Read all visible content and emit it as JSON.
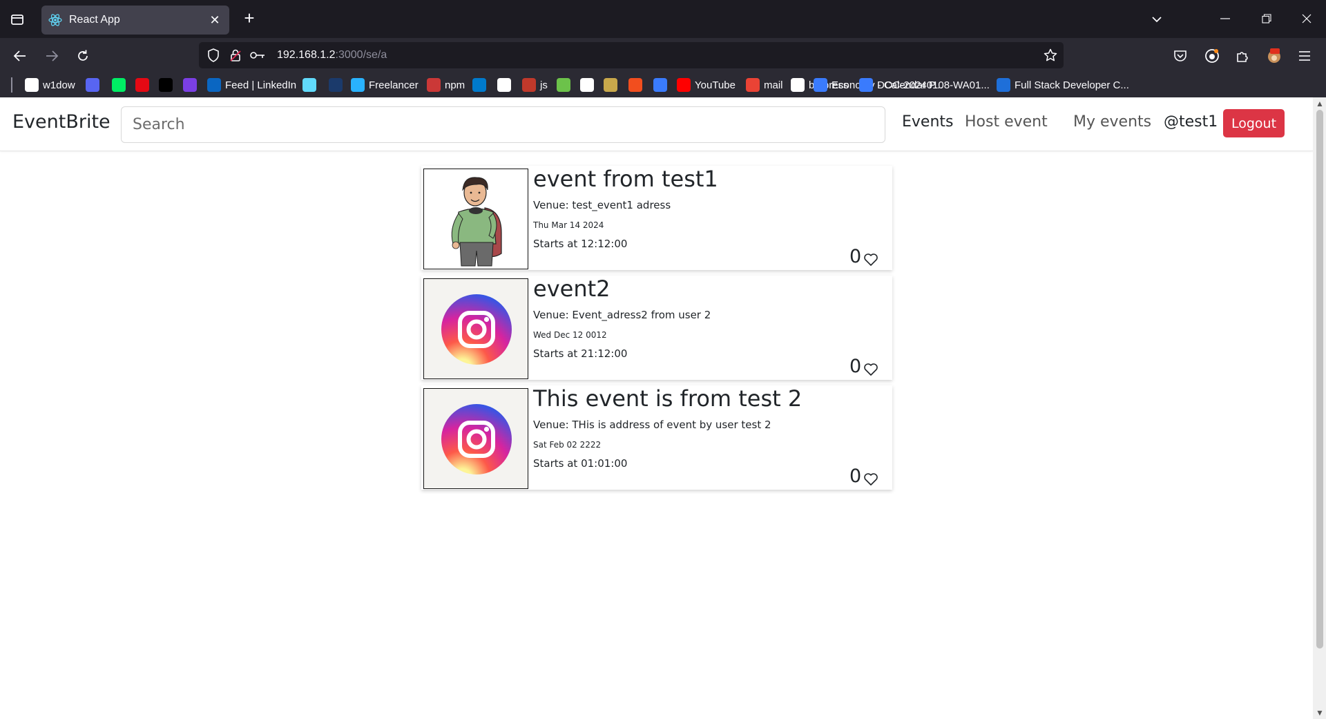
{
  "browser": {
    "tab_title": "React App",
    "url_host": "192.168.1.2",
    "url_rest": ":3000/se/a",
    "bookmarks": [
      {
        "label": "w1dow",
        "color": "#ffffff",
        "icon": "w1dow-icon"
      },
      {
        "label": "",
        "color": "#5865f2",
        "icon": "discord-icon"
      },
      {
        "label": "",
        "color": "#00ed64",
        "icon": "mongodb-icon"
      },
      {
        "label": "",
        "color": "#e50914",
        "icon": "ns-icon"
      },
      {
        "label": "",
        "color": "#000000",
        "icon": "pulse-icon"
      },
      {
        "label": "",
        "color": "#7b3fe4",
        "icon": "crown-icon"
      },
      {
        "label": "Feed | LinkedIn",
        "color": "#0a66c2",
        "icon": "linkedin-icon"
      },
      {
        "label": "",
        "color": "#61dafb",
        "icon": "react-icon"
      },
      {
        "label": "",
        "color": "#1b3a6b",
        "icon": "cloud-icon"
      },
      {
        "label": "Freelancer",
        "color": "#29b2fe",
        "icon": "freelancer-icon"
      },
      {
        "label": "npm",
        "color": "#cb3837",
        "icon": "npm-icon"
      },
      {
        "label": "",
        "color": "#007acc",
        "icon": "vscode-icon"
      },
      {
        "label": "",
        "color": "#ffffff",
        "icon": "github-icon"
      },
      {
        "label": "js",
        "color": "#c0392b",
        "icon": "js-icon"
      },
      {
        "label": "",
        "color": "#6cc24a",
        "icon": "nodejs-icon"
      },
      {
        "label": "",
        "color": "#ffffff",
        "icon": "wordpress-icon"
      },
      {
        "label": "",
        "color": "#c8a84b",
        "icon": "hat-icon"
      },
      {
        "label": "",
        "color": "#f24e1e",
        "icon": "figma-icon"
      },
      {
        "label": "",
        "color": "#3a7bfd",
        "icon": "c-icon"
      },
      {
        "label": "YouTube",
        "color": "#ff0000",
        "icon": "youtube-icon"
      },
      {
        "label": "mail",
        "color": "#ea4335",
        "icon": "gmail-icon"
      },
      {
        "label": "botpress",
        "color": "#ffffff",
        "icon": "botpress-icon"
      },
      {
        "label": "Economy - Calendar P...",
        "color": "#3a7bfd",
        "icon": "c-icon"
      },
      {
        "label": "DOC-20240108-WA01...",
        "color": "#3a7bfd",
        "icon": "c-icon"
      },
      {
        "label": "Full Stack Developer C...",
        "color": "#1e6fd9",
        "icon": "ist-icon"
      }
    ]
  },
  "app": {
    "brand": "EventBrite",
    "search_placeholder": "Search",
    "nav": {
      "events": "Events",
      "host_event": "Host event",
      "my_events": "My events",
      "user": "@test1",
      "logout": "Logout"
    },
    "events": [
      {
        "title": "event from test1",
        "venue": "Venue: test_event1 adress",
        "date": "Thu Mar 14 2024",
        "starts": "Starts at 12:12:00",
        "likes": "0",
        "image": "person-illustration"
      },
      {
        "title": "event2",
        "venue": "Venue: Event_adress2 from user 2",
        "date": "Wed Dec 12 0012",
        "starts": "Starts at 21:12:00",
        "likes": "0",
        "image": "instagram-logo"
      },
      {
        "title": "This event is from test 2",
        "venue": "Venue: THis is address of event by user test 2",
        "date": "Sat Feb 02 2222",
        "starts": "Starts at 01:01:00",
        "likes": "0",
        "image": "instagram-logo"
      }
    ]
  },
  "colors": {
    "logout": "#dc3545",
    "chrome_dark": "#1c1b22",
    "chrome_bar": "#2b2a33"
  }
}
